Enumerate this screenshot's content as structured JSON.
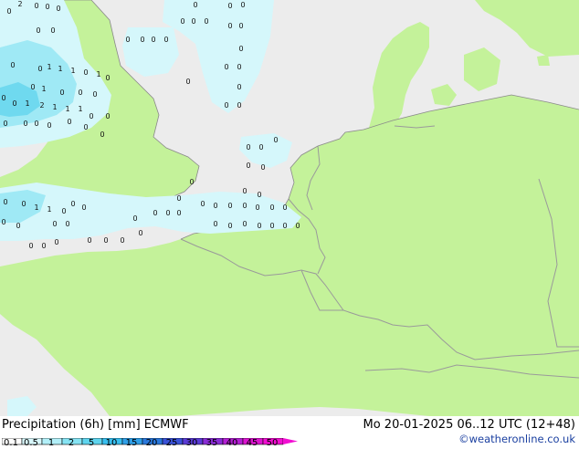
{
  "map": {
    "colors": {
      "sea": "#ececec",
      "land": "#c4f29a",
      "border": "#9a9a9a",
      "coast": "#8a8a8a",
      "precip_light": "#d5f7fb",
      "precip_mid": "#9fe9f5",
      "precip_strong": "#6fd9ef"
    },
    "value_labels": [
      "2",
      "0",
      "0",
      "0",
      "0",
      "0",
      "0",
      "0",
      "0",
      "0",
      "0",
      "0",
      "0",
      "0",
      "0",
      "0",
      "0",
      "0",
      "0",
      "0",
      "1",
      "1",
      "1",
      "0",
      "1",
      "0",
      "0",
      "0",
      "0",
      "0",
      "1",
      "2",
      "1",
      "1",
      "1",
      "0",
      "0",
      "0",
      "1",
      "0",
      "0",
      "0",
      "0",
      "0",
      "0",
      "0",
      "0",
      "0",
      "0",
      "0",
      "0",
      "0",
      "0",
      "0",
      "0",
      "0",
      "0",
      "0",
      "0",
      "0",
      "0",
      "0",
      "0",
      "0",
      "0",
      "0",
      "0",
      "0",
      "0",
      "0",
      "1",
      "1",
      "0",
      "0",
      "0",
      "0",
      "0",
      "0",
      "0",
      "0",
      "0",
      "0",
      "0",
      "0",
      "0",
      "0",
      "0",
      "0",
      "0",
      "0",
      "0",
      "0",
      "0",
      "0",
      "0",
      "0",
      "0",
      "0",
      "0",
      "0"
    ]
  },
  "footer": {
    "title": "Precipitation (6h) [mm] ECMWF",
    "valid_time": "Mo 20-01-2025 06..12 UTC (12+48)",
    "credit": "©weatheronline.co.uk"
  },
  "legend": {
    "ticks": [
      "0.1",
      "0.5",
      "1",
      "2",
      "5",
      "10",
      "15",
      "20",
      "25",
      "30",
      "35",
      "40",
      "45",
      "50"
    ],
    "colors": [
      "#fefefe",
      "#d8f7fb",
      "#b2eff8",
      "#86e3f3",
      "#5fd4ee",
      "#38bff0",
      "#2f9fe8",
      "#2a78dc",
      "#3a52d8",
      "#5a3bd6",
      "#8a2cd6",
      "#b41fd4",
      "#dc14d0",
      "#f20ed2"
    ]
  }
}
